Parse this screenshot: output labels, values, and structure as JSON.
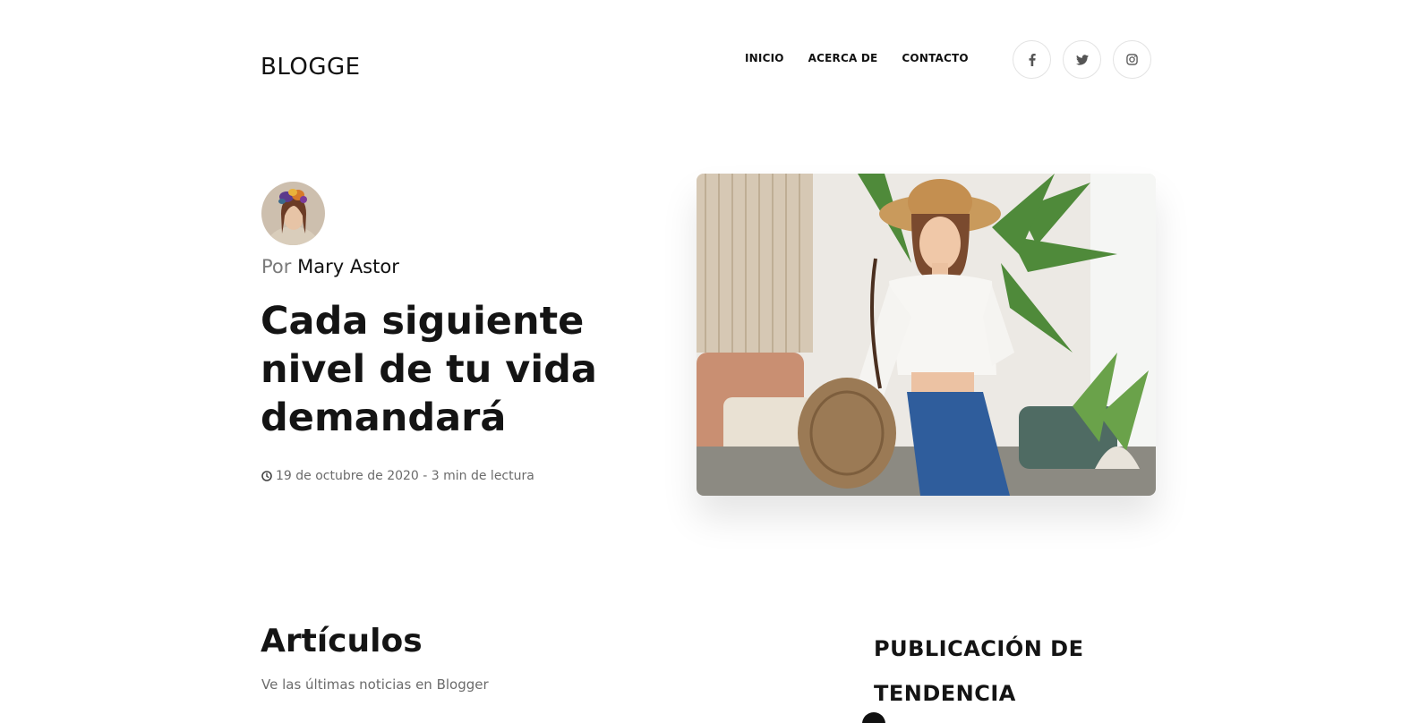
{
  "header": {
    "logo": "BLOGGE",
    "nav": [
      {
        "label": "INICIO"
      },
      {
        "label": "ACERCA DE"
      },
      {
        "label": "CONTACTO"
      }
    ],
    "social": [
      {
        "icon": "facebook-icon"
      },
      {
        "icon": "twitter-icon"
      },
      {
        "icon": "instagram-icon"
      }
    ]
  },
  "hero": {
    "by_prefix": "Por",
    "author": "Mary Astor",
    "title": "Cada siguiente nivel de tu vida demandará",
    "meta": "19 de octubre de 2020 - 3 min de lectura"
  },
  "articles": {
    "title": "Artículos",
    "subtitle": "Ve las últimas noticias en Blogger"
  },
  "trending": {
    "title": "PUBLICACIÓN DE TENDENCIA"
  }
}
